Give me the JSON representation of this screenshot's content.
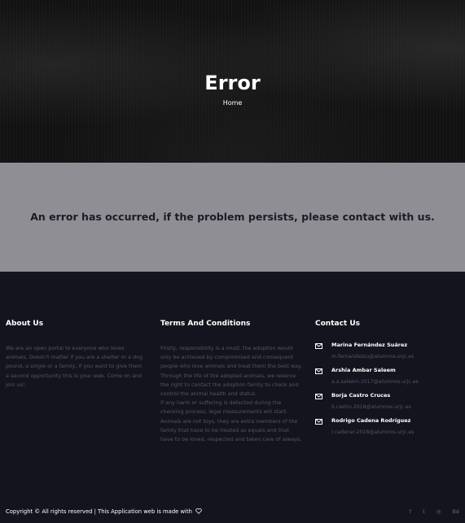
{
  "hero": {
    "title": "Error",
    "breadcrumb": "Home"
  },
  "error": {
    "message": "An error has occurred, if the problem persists, please contact with us."
  },
  "footer": {
    "about": {
      "title": "About Us",
      "text": "We are an open portal to everyone who loves animals. Doesn't matter if you are a shelter or a dog pound, a single or a family, if you want to give them a second opportunity this is your web. Come on and join us!"
    },
    "terms": {
      "title": "Terms And Conditions",
      "text1": "Firstly, responsibility is a must, the adoption would only be achieved by compromised and consequent people who love animals and treat them the best way.",
      "text2": "Through the life of the adopted animals, we reserve the right to contact the adoption family to check and control the animal health and status.",
      "text3": "If any harm or suffering is detected during the checking process, legal measurements will start. Animals are not toys, they are extra members of the family that have to be treated as equals and that have to be loved, respected and taken care of always."
    },
    "contact": {
      "title": "Contact Us",
      "people": [
        {
          "name": "Marina Fernández Suárez",
          "email": "m.fernandezsu@alumnos.urjc.es"
        },
        {
          "name": "Arshia Ambar Saleem",
          "email": "a.a.saleem.2017@alumnos.urjc.es"
        },
        {
          "name": "Borja Castro Cruces",
          "email": "b.castro.2018@alumnos.urjc.es"
        },
        {
          "name": "Rodrigo Cadena Rodríguez",
          "email": "r.cadenar.2018@alumnos.urjc.es"
        }
      ]
    },
    "copyright": "Copyright © All rights reserved | This Application web is made with",
    "socials": {
      "facebook": "f",
      "twitter": "t",
      "dribbble": "◎",
      "behance": "Bē"
    }
  },
  "colors": {
    "hero_bg": "#121212",
    "error_band": "#8f8e94",
    "footer_bg": "#14141f",
    "muted_text": "#55555f"
  }
}
